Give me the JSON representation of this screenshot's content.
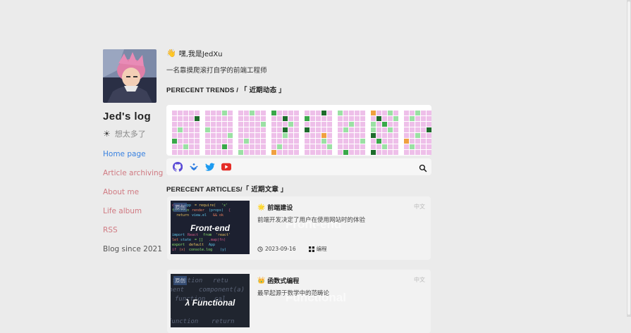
{
  "sidebar": {
    "site_title": "Jed's log",
    "motto": "想太多了",
    "nav": [
      {
        "label": "Home page",
        "state": "active"
      },
      {
        "label": "Article archiving",
        "state": "link"
      },
      {
        "label": "About me",
        "state": "link"
      },
      {
        "label": "Life album",
        "state": "link"
      },
      {
        "label": "RSS",
        "state": "link"
      },
      {
        "label": "Blog since 2021",
        "state": "plain"
      }
    ]
  },
  "main": {
    "greeting": "嘿,我是JedXu",
    "intro": "一名靠摸爬滚打自学的前端工程师",
    "trends_heading": "PERECENT TRENDS / 「 近期动态 」",
    "articles_heading": "PERECENT ARTICLES/「 近期文章 」",
    "calendar_levels": [
      "PPPPP PPPPD PPPPP PPPPP PDPPP PPPPP PLPPP",
      "PPPPP PLPPP PPPPP PPPPP PPPPP PDPPP PPPPP",
      "PPPPP PPPPP PPPPP PPPPP PPPPP PPPPP PPPPP",
      "PPPPP PPPPP PPPPP PPPPP PPPPP PPPPP PPPPP",
      "PPPPP PPPPP PPPPP PPPPP PPPPP PPPPP PPPPP",
      "PPPPP PPPPP PPPPP PPPPP PPPPP PPPPP PPPPP",
      "PPPPP PPPPP PPPPP PPPPP PPPPP PPPPP PPPPP",
      "PPPPP PPPPP PPPPP PPPPP PPPPP PPPPP PPPPP"
    ],
    "toolbar_icons": [
      "github-icon",
      "juejin-icon",
      "twitter-icon",
      "youtube-icon",
      "search-icon"
    ],
    "articles": [
      {
        "badge": "原创",
        "thumb_title": "Front-end",
        "emoji": "🌟",
        "title": "前端建设",
        "lang": "中文",
        "desc": "前端开发决定了用户在使用网站时的体验",
        "ghost": "Front-end",
        "date": "2023-09-16",
        "tag": "编程"
      },
      {
        "badge": "原创",
        "thumb_title": "Functional",
        "emoji": "👑",
        "title": "函数式编程",
        "lang": "中文",
        "desc": "最早起源于数学中的范畴论",
        "ghost": "Functional",
        "date": "",
        "tag": ""
      }
    ]
  },
  "colors": {
    "pink": "#eebfe9",
    "light_green": "#9be0a4",
    "mid_green": "#3aa84a",
    "dark_green": "#1e6b2c",
    "orange": "#f0a040",
    "link": "#d07a82",
    "active_link": "#3a82e0"
  }
}
